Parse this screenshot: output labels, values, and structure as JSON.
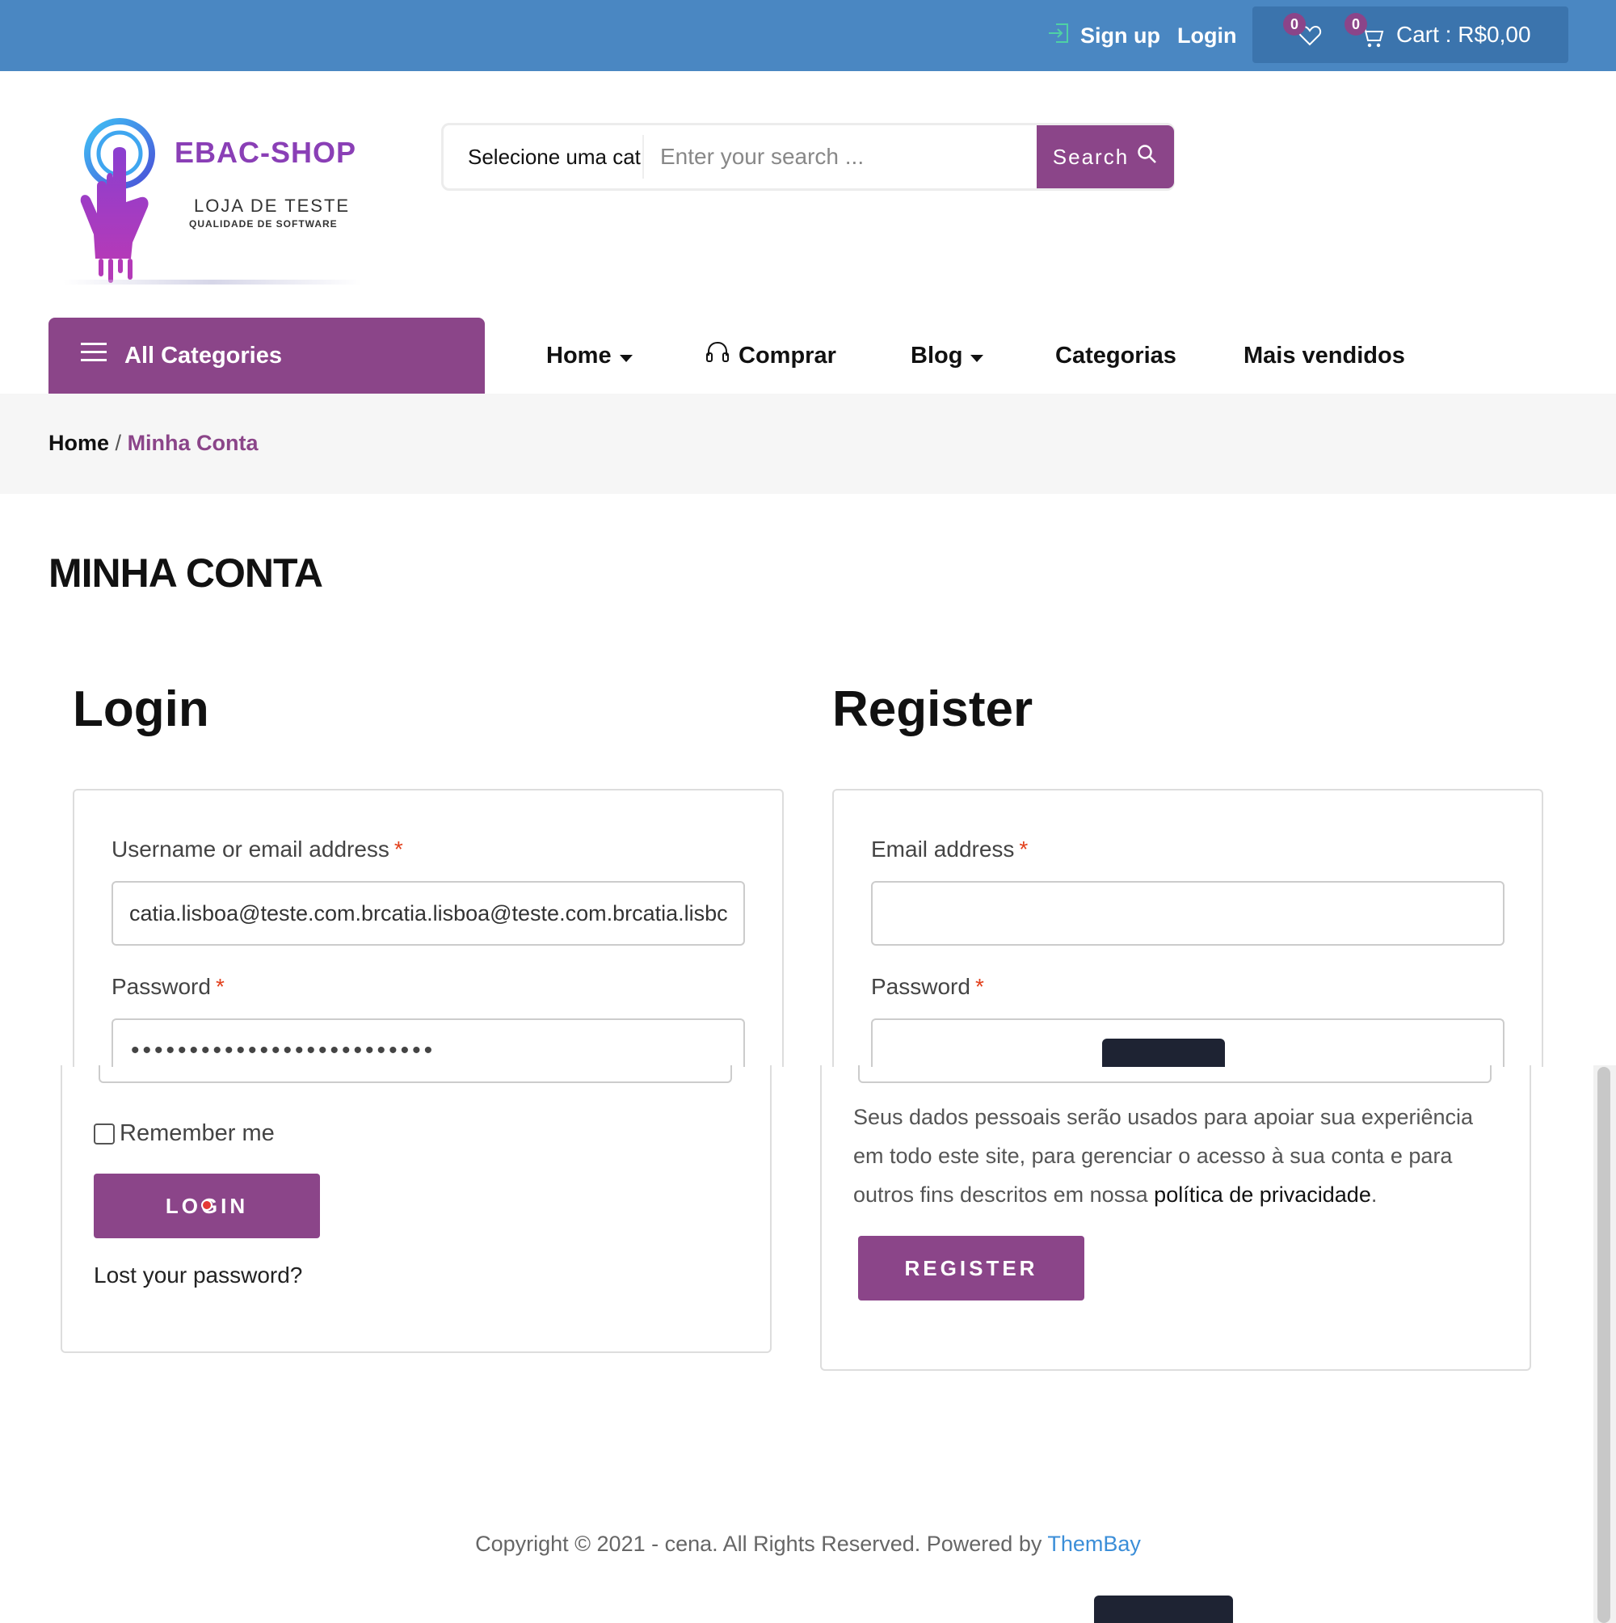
{
  "topbar": {
    "signup_label": "Sign up",
    "login_label": "Login",
    "wishlist_count": "0",
    "cart_count": "0",
    "cart_label": "Cart : R$0,00",
    "bg_color": "#4a87c2"
  },
  "logo": {
    "title": "EBAC-SHOP",
    "subtitle": "LOJA DE TESTE",
    "tagline": "QUALIDADE DE SOFTWARE"
  },
  "search": {
    "category_label": "Selecione uma cat",
    "placeholder": "Enter your search ...",
    "button_label": "Search"
  },
  "nav": {
    "all_categories": "All Categories",
    "items": [
      {
        "label": "Home"
      },
      {
        "label": "Comprar"
      },
      {
        "label": "Blog"
      },
      {
        "label": "Categorias"
      },
      {
        "label": "Mais vendidos"
      }
    ]
  },
  "breadcrumb": {
    "home": "Home",
    "separator": "/",
    "current": "Minha Conta"
  },
  "page_title": "MINHA CONTA",
  "login": {
    "title": "Login",
    "username_label": "Username or email address",
    "username_value": "catia.lisboa@teste.com.brcatia.lisboa@teste.com.brcatia.lisbc",
    "password_label": "Password",
    "password_value": "••••••••••••••••••••••••••",
    "required_mark": "*",
    "remember_label": "Remember me",
    "button_label": "LOGIN",
    "lost_password": "Lost your password?"
  },
  "register": {
    "title": "Register",
    "email_label": "Email address",
    "email_value": "",
    "password_label": "Password",
    "required_mark": "*",
    "privacy_text": "Seus dados pessoais serão usados para apoiar sua experiência em todo este site, para gerenciar o acesso à sua conta e para outros fins descritos em nossa ",
    "privacy_link": "política de privacidade",
    "privacy_end": ".",
    "button_label": "REGISTER"
  },
  "footer": {
    "copyright": "Copyright © 2021 - cena. All Rights Reserved. Powered by ",
    "brand": "ThemBay"
  },
  "colors": {
    "accent": "#8b4589",
    "link_blue": "#3b8ed8",
    "required": "#e2401c"
  }
}
